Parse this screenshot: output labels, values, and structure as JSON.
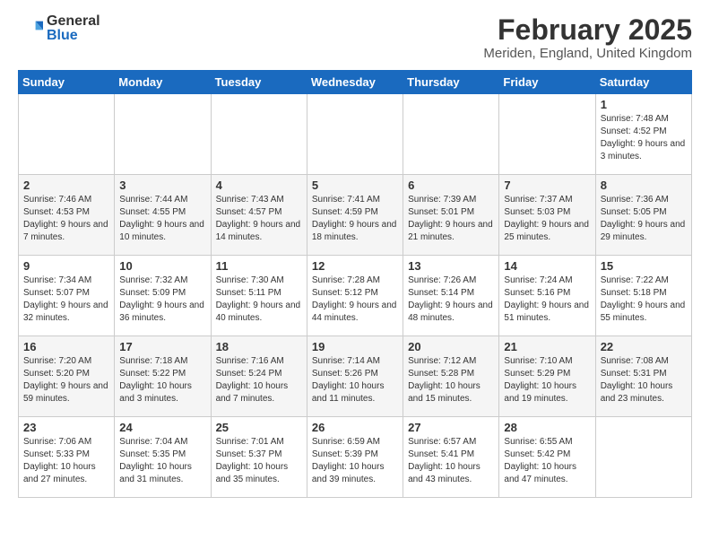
{
  "logo": {
    "general": "General",
    "blue": "Blue"
  },
  "title": "February 2025",
  "subtitle": "Meriden, England, United Kingdom",
  "days_of_week": [
    "Sunday",
    "Monday",
    "Tuesday",
    "Wednesday",
    "Thursday",
    "Friday",
    "Saturday"
  ],
  "weeks": [
    [
      {
        "day": "",
        "info": ""
      },
      {
        "day": "",
        "info": ""
      },
      {
        "day": "",
        "info": ""
      },
      {
        "day": "",
        "info": ""
      },
      {
        "day": "",
        "info": ""
      },
      {
        "day": "",
        "info": ""
      },
      {
        "day": "1",
        "info": "Sunrise: 7:48 AM\nSunset: 4:52 PM\nDaylight: 9 hours and 3 minutes."
      }
    ],
    [
      {
        "day": "2",
        "info": "Sunrise: 7:46 AM\nSunset: 4:53 PM\nDaylight: 9 hours and 7 minutes."
      },
      {
        "day": "3",
        "info": "Sunrise: 7:44 AM\nSunset: 4:55 PM\nDaylight: 9 hours and 10 minutes."
      },
      {
        "day": "4",
        "info": "Sunrise: 7:43 AM\nSunset: 4:57 PM\nDaylight: 9 hours and 14 minutes."
      },
      {
        "day": "5",
        "info": "Sunrise: 7:41 AM\nSunset: 4:59 PM\nDaylight: 9 hours and 18 minutes."
      },
      {
        "day": "6",
        "info": "Sunrise: 7:39 AM\nSunset: 5:01 PM\nDaylight: 9 hours and 21 minutes."
      },
      {
        "day": "7",
        "info": "Sunrise: 7:37 AM\nSunset: 5:03 PM\nDaylight: 9 hours and 25 minutes."
      },
      {
        "day": "8",
        "info": "Sunrise: 7:36 AM\nSunset: 5:05 PM\nDaylight: 9 hours and 29 minutes."
      }
    ],
    [
      {
        "day": "9",
        "info": "Sunrise: 7:34 AM\nSunset: 5:07 PM\nDaylight: 9 hours and 32 minutes."
      },
      {
        "day": "10",
        "info": "Sunrise: 7:32 AM\nSunset: 5:09 PM\nDaylight: 9 hours and 36 minutes."
      },
      {
        "day": "11",
        "info": "Sunrise: 7:30 AM\nSunset: 5:11 PM\nDaylight: 9 hours and 40 minutes."
      },
      {
        "day": "12",
        "info": "Sunrise: 7:28 AM\nSunset: 5:12 PM\nDaylight: 9 hours and 44 minutes."
      },
      {
        "day": "13",
        "info": "Sunrise: 7:26 AM\nSunset: 5:14 PM\nDaylight: 9 hours and 48 minutes."
      },
      {
        "day": "14",
        "info": "Sunrise: 7:24 AM\nSunset: 5:16 PM\nDaylight: 9 hours and 51 minutes."
      },
      {
        "day": "15",
        "info": "Sunrise: 7:22 AM\nSunset: 5:18 PM\nDaylight: 9 hours and 55 minutes."
      }
    ],
    [
      {
        "day": "16",
        "info": "Sunrise: 7:20 AM\nSunset: 5:20 PM\nDaylight: 9 hours and 59 minutes."
      },
      {
        "day": "17",
        "info": "Sunrise: 7:18 AM\nSunset: 5:22 PM\nDaylight: 10 hours and 3 minutes."
      },
      {
        "day": "18",
        "info": "Sunrise: 7:16 AM\nSunset: 5:24 PM\nDaylight: 10 hours and 7 minutes."
      },
      {
        "day": "19",
        "info": "Sunrise: 7:14 AM\nSunset: 5:26 PM\nDaylight: 10 hours and 11 minutes."
      },
      {
        "day": "20",
        "info": "Sunrise: 7:12 AM\nSunset: 5:28 PM\nDaylight: 10 hours and 15 minutes."
      },
      {
        "day": "21",
        "info": "Sunrise: 7:10 AM\nSunset: 5:29 PM\nDaylight: 10 hours and 19 minutes."
      },
      {
        "day": "22",
        "info": "Sunrise: 7:08 AM\nSunset: 5:31 PM\nDaylight: 10 hours and 23 minutes."
      }
    ],
    [
      {
        "day": "23",
        "info": "Sunrise: 7:06 AM\nSunset: 5:33 PM\nDaylight: 10 hours and 27 minutes."
      },
      {
        "day": "24",
        "info": "Sunrise: 7:04 AM\nSunset: 5:35 PM\nDaylight: 10 hours and 31 minutes."
      },
      {
        "day": "25",
        "info": "Sunrise: 7:01 AM\nSunset: 5:37 PM\nDaylight: 10 hours and 35 minutes."
      },
      {
        "day": "26",
        "info": "Sunrise: 6:59 AM\nSunset: 5:39 PM\nDaylight: 10 hours and 39 minutes."
      },
      {
        "day": "27",
        "info": "Sunrise: 6:57 AM\nSunset: 5:41 PM\nDaylight: 10 hours and 43 minutes."
      },
      {
        "day": "28",
        "info": "Sunrise: 6:55 AM\nSunset: 5:42 PM\nDaylight: 10 hours and 47 minutes."
      },
      {
        "day": "",
        "info": ""
      }
    ]
  ]
}
